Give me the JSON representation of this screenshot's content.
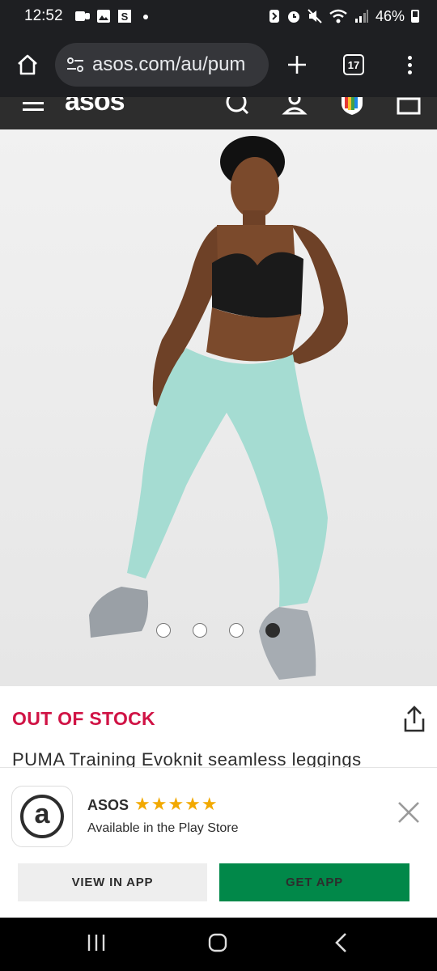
{
  "status_bar": {
    "time": "12:52",
    "battery": "46%",
    "icons": [
      "teams-icon",
      "gallery-icon",
      "s-app-icon",
      "dot-icon",
      "nfc-icon",
      "alarm-icon",
      "mute-icon",
      "wifi-icon",
      "signal-icon",
      "battery-icon"
    ]
  },
  "browser": {
    "url": "asos.com/au/pum",
    "tab_count": "17"
  },
  "site_header": {
    "logo": "asos"
  },
  "product": {
    "stock_status": "OUT OF STOCK",
    "title": "PUMA Training Evoknit seamless leggings",
    "image_count": 4,
    "active_image_index": 3
  },
  "app_banner": {
    "app_name": "ASOS",
    "rating_stars": 5,
    "stars_text": "★★★★★",
    "store_text": "Available in the Play Store",
    "view_label": "VIEW IN APP",
    "get_label": "GET APP"
  },
  "colors": {
    "stock_red": "#d01345",
    "get_app_green": "#018849",
    "star_gold": "#f2a900",
    "header_dark": "#2d2d2d"
  }
}
